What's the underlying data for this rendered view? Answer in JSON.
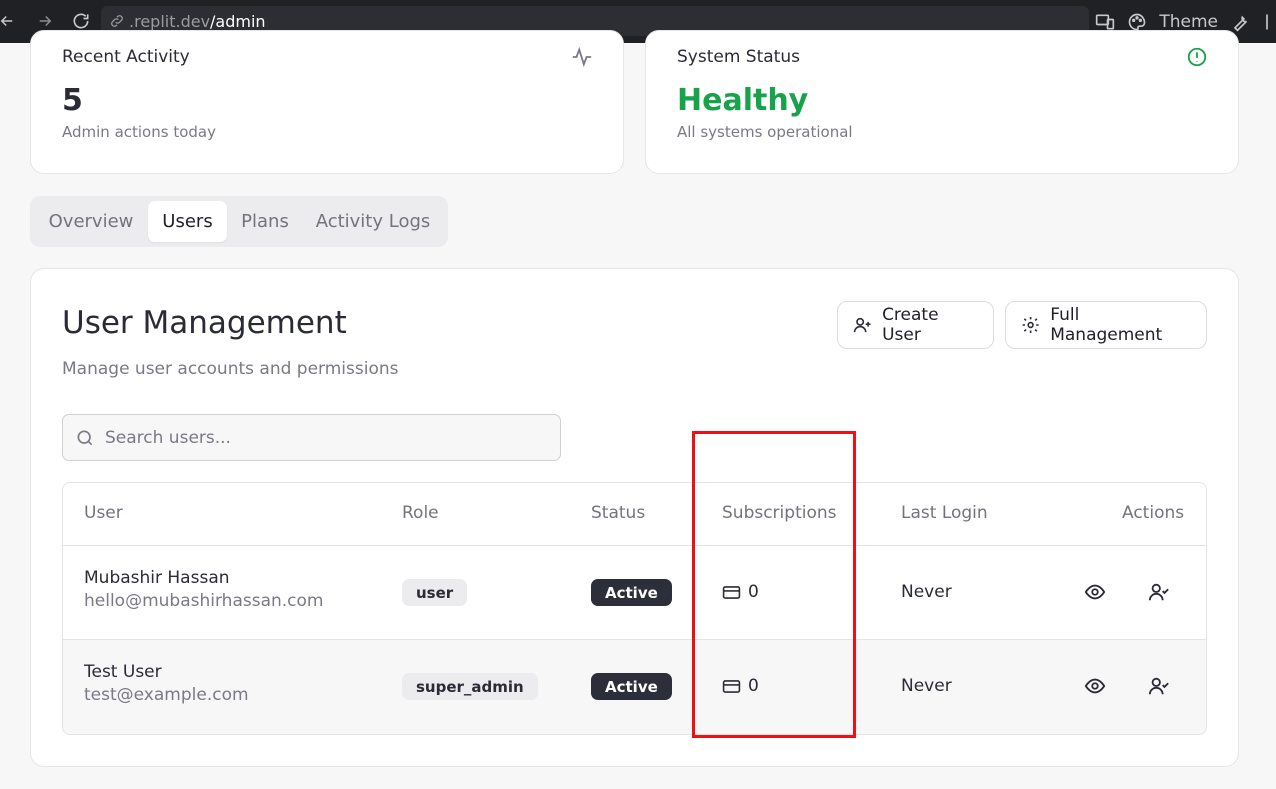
{
  "browser": {
    "url_host": ".replit.dev",
    "url_path": "/admin",
    "theme_label": "Theme"
  },
  "stats": {
    "activity": {
      "label": "Recent Activity",
      "value": "5",
      "sub": "Admin actions today"
    },
    "system": {
      "label": "System Status",
      "value": "Healthy",
      "sub": "All systems operational",
      "value_color": "#16a34a"
    }
  },
  "tabs": [
    {
      "label": "Overview"
    },
    {
      "label": "Users"
    },
    {
      "label": "Plans"
    },
    {
      "label": "Activity Logs"
    }
  ],
  "active_tab": "Users",
  "panel": {
    "title": "User Management",
    "subtitle": "Manage user accounts and permissions",
    "create_button": "Create User",
    "manage_button": "Full Management",
    "search_placeholder": "Search users..."
  },
  "table": {
    "headers": [
      "User",
      "Role",
      "Status",
      "Subscriptions",
      "Last Login",
      "Actions"
    ],
    "rows": [
      {
        "name": "Mubashir Hassan",
        "email": "hello@mubashirhassan.com",
        "role": "user",
        "status": "Active",
        "subscriptions": "0",
        "last_login": "Never"
      },
      {
        "name": "Test User",
        "email": "test@example.com",
        "role": "super_admin",
        "status": "Active",
        "subscriptions": "0",
        "last_login": "Never"
      }
    ]
  },
  "colors": {
    "accent_dark": "#2c2f3a",
    "healthy": "#16a34a",
    "highlight": "#ee1111"
  }
}
